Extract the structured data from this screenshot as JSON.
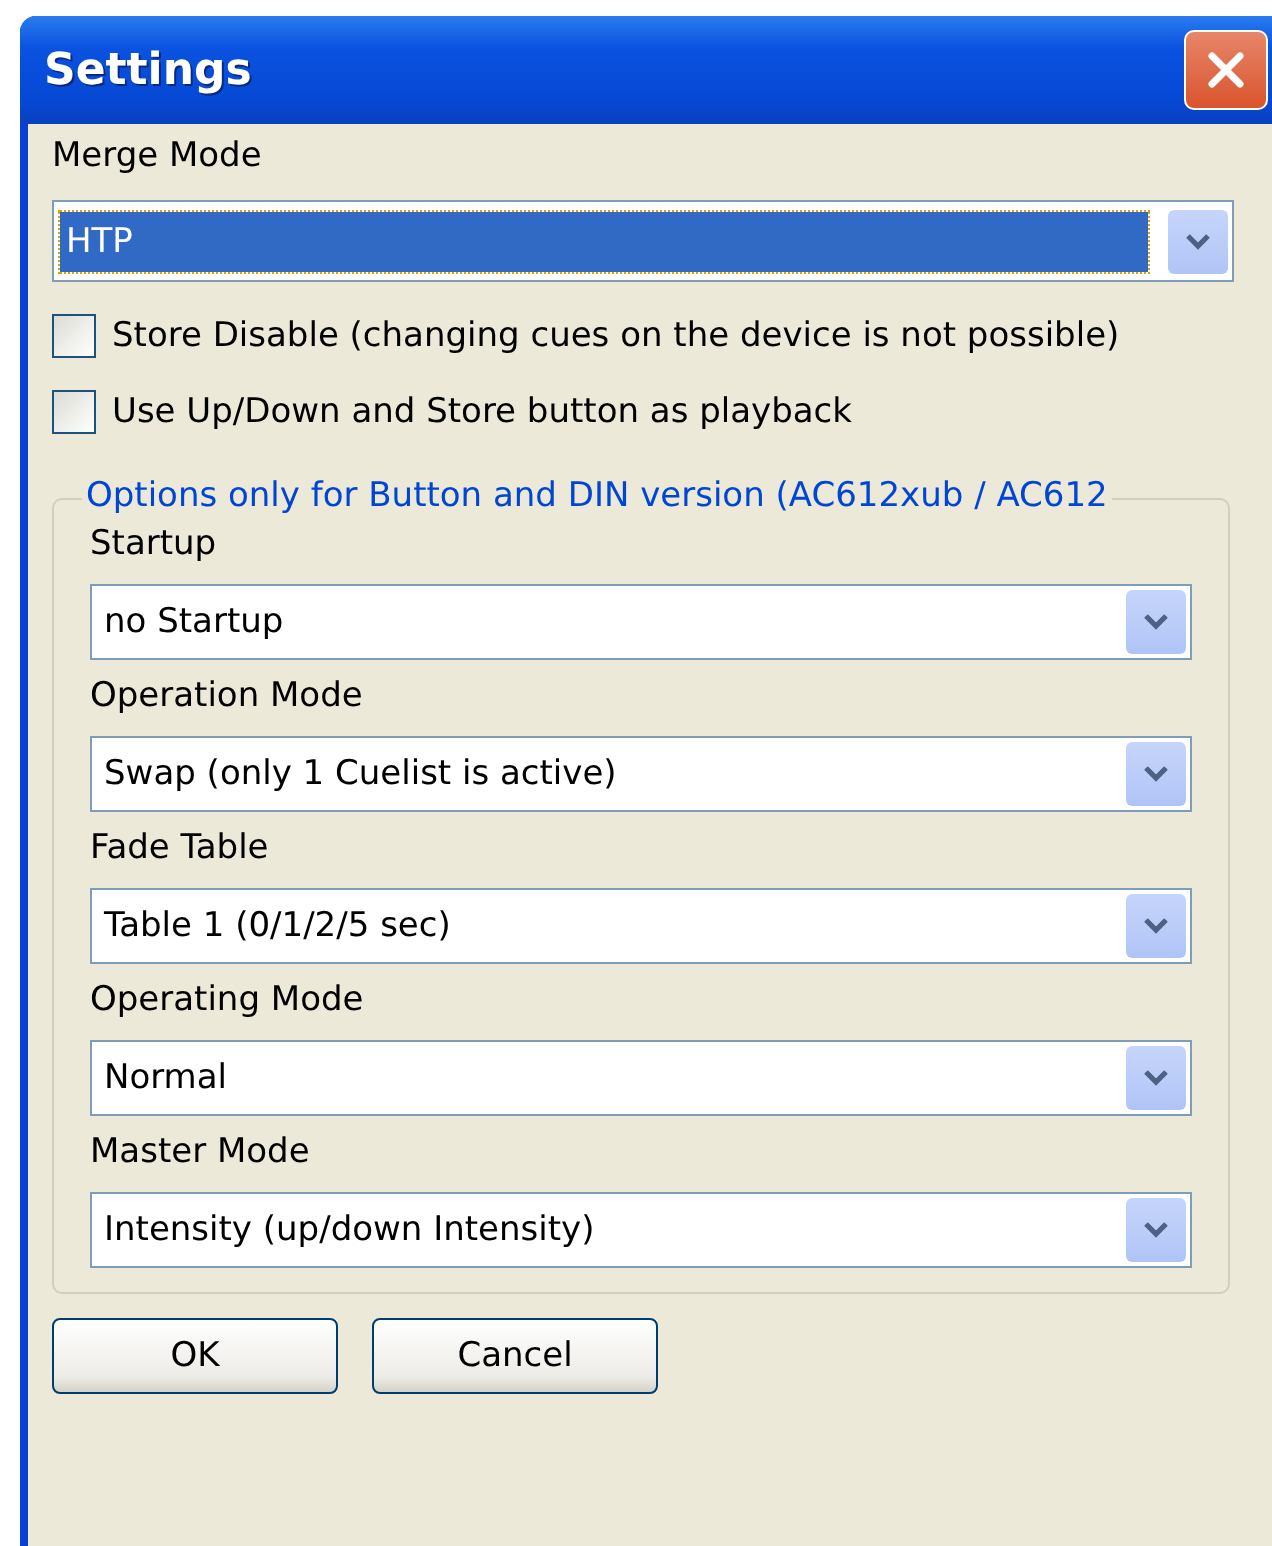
{
  "window": {
    "title": "Settings"
  },
  "merge_mode": {
    "label": "Merge Mode",
    "value": "HTP",
    "focused": true
  },
  "checkboxes": [
    {
      "label": "Store Disable (changing cues on the device is not possible)",
      "checked": false
    },
    {
      "label": "Use Up/Down and Store button as playback",
      "checked": false
    }
  ],
  "group": {
    "legend": "Options only for Button and DIN version (AC612xub / AC612",
    "fields": [
      {
        "label": "Startup",
        "value": "no Startup",
        "focused": false
      },
      {
        "label": "Operation Mode",
        "value": "Swap (only 1 Cuelist is active)",
        "focused": false
      },
      {
        "label": "Fade Table",
        "value": "Table 1 (0/1/2/5 sec)",
        "focused": false
      },
      {
        "label": "Operating Mode",
        "value": "Normal",
        "focused": false
      },
      {
        "label": "Master Mode",
        "value": "Intensity (up/down Intensity)",
        "focused": false
      }
    ]
  },
  "buttons": [
    {
      "label": "OK"
    },
    {
      "label": "Cancel"
    }
  ]
}
